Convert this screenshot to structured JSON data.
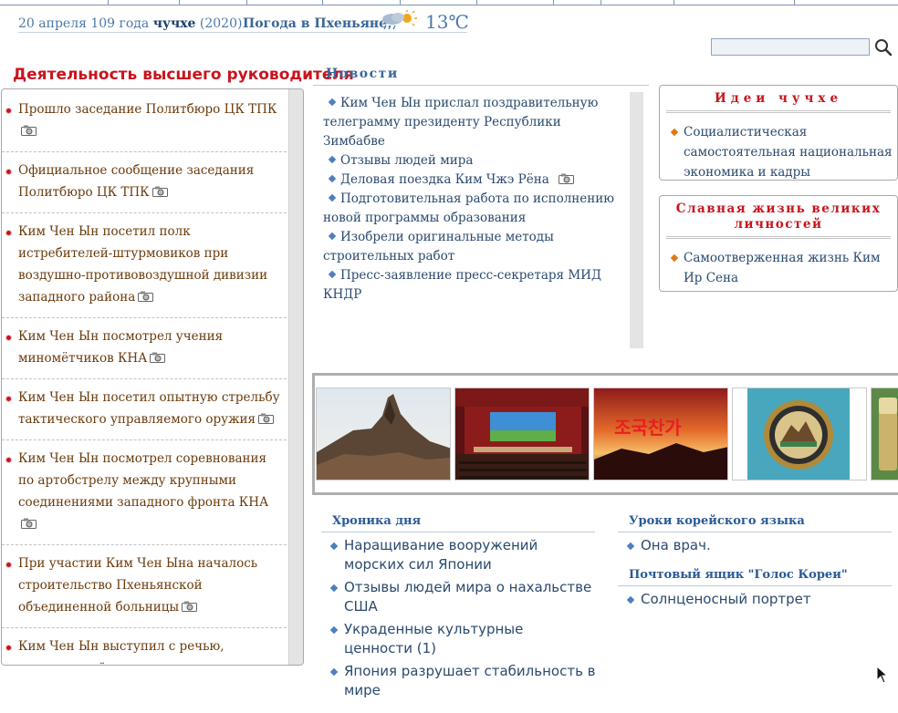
{
  "header": {
    "date_prefix": "20 апреля 109 года",
    "date_juche": "чучхе",
    "date_year": "(2020)",
    "weather_label": "Погода в Пхеньяне",
    "weather_colon": ":",
    "weather_icon": "cloud-rain-sun-icon",
    "temperature": "13℃"
  },
  "search": {
    "placeholder": "",
    "icon": "magnifier-icon"
  },
  "leadership": {
    "title": "Деятельность высшего руководителя",
    "items": [
      {
        "text": "Прошло заседание Политбюро ЦК ТПК"
      },
      {
        "text": "Официальное сообщение заседания Политбюро ЦК ТПК"
      },
      {
        "text": "Ким Чен Ын посетил полк истребителей-штурмовиков при воздушно-противовоздушной дивизии западного района"
      },
      {
        "text": "Ким Чен Ын посмотрел учения миномётчиков КНА"
      },
      {
        "text": "Ким Чен Ын посетил опытную стрельбу тактического управляемого оружия"
      },
      {
        "text": "Ким Чен Ын посмотрел соревнования по артобстрелу между крупными соединениями западного фронта КНА"
      },
      {
        "text": "При участии Ким Чен Ына началось строительство Пхеньянской объединенной больницы"
      },
      {
        "text": "Ким Чен Ын выступил с речью, посвященной началу строительства Пхеньянской объединенной больницы"
      }
    ]
  },
  "news": {
    "title": "Новости",
    "items": [
      {
        "text": "Ким Чен Ын прислал поздравительную телеграмму президенту Республики Зимбабве",
        "photo": false
      },
      {
        "text": "Отзывы людей мира",
        "photo": false
      },
      {
        "text": "Деловая поездка Ким Чжэ Рёна",
        "photo": true
      },
      {
        "text": "Подготовительная работа по исполнению новой программы образования",
        "photo": false
      },
      {
        "text": "Изобрели оригинальные методы строительных работ",
        "photo": false
      },
      {
        "text": "Пресс-заявление пресс-секретаря МИД КНДР",
        "photo": false
      }
    ]
  },
  "juche_box": {
    "title": "Идеи чучхе",
    "items": [
      {
        "text": "Социалистическая самостоятельная национальная экономика и кадры"
      }
    ]
  },
  "glory_box": {
    "title": "Славная жизнь великих личностей",
    "items": [
      {
        "text": "Самоотверженная жизнь Ким Ир Сена"
      }
    ]
  },
  "gallery": {
    "images": [
      "mountain-peak-photo",
      "concert-stage-photo",
      "sunrise-calligraphy-photo",
      "decorative-plate-photo",
      "lighter-photo"
    ],
    "calligraphy": "조국찬가"
  },
  "chronicle": {
    "title": "Хроника дня",
    "items": [
      {
        "text": "Наращивание вооружений морских сил Японии"
      },
      {
        "text": "Отзывы людей мира о нахальстве США"
      },
      {
        "text": "Украденные культурные ценности (1)"
      },
      {
        "text": "Япония разрушает стабильность в мире"
      }
    ]
  },
  "lessons": {
    "title": "Уроки корейского языка",
    "items": [
      {
        "text": "Она врач."
      }
    ]
  },
  "mailbox": {
    "title": "Почтовый ящик \"Голос Кореи\"",
    "items": [
      {
        "text": "Солнценосный портрет"
      }
    ]
  }
}
